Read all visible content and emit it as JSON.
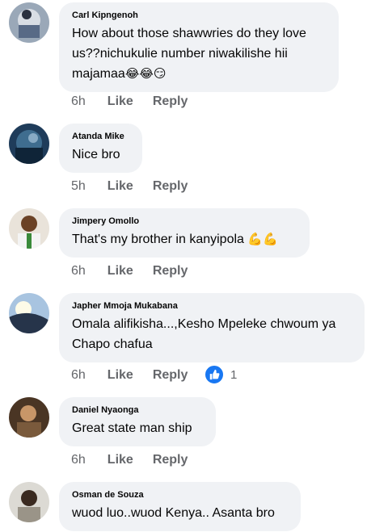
{
  "actions": {
    "like_label": "Like",
    "reply_label": "Reply"
  },
  "comments": [
    {
      "author": "Carl Kipngenoh",
      "text": "How about those shawwries do they love us??nichukulie number niwakilishe hii majamaa",
      "emoji": "😂😂😏",
      "time": "6h"
    },
    {
      "author": "Atanda Mike",
      "text": "Nice bro",
      "emoji": "",
      "time": "5h"
    },
    {
      "author": "Jimpery Omollo",
      "text": "That's my brother in kanyipola ",
      "emoji": "💪💪",
      "time": "6h"
    },
    {
      "author": "Japher Mmoja Mukabana",
      "text": "Omala alifikisha...,Kesho Mpeleke chwoum ya Chapo chafua",
      "emoji": "",
      "time": "6h",
      "reactions": "1"
    },
    {
      "author": "Daniel Nyaonga",
      "text": "Great state man ship",
      "emoji": "",
      "time": "6h"
    },
    {
      "author": "Osman de Souza",
      "text": "wuod luo..wuod Kenya.. Asanta bro",
      "emoji": "",
      "time": ""
    }
  ],
  "colors": {
    "bubble": "#f0f2f5",
    "meta": "#65676b",
    "like_badge": "#1877f2"
  }
}
